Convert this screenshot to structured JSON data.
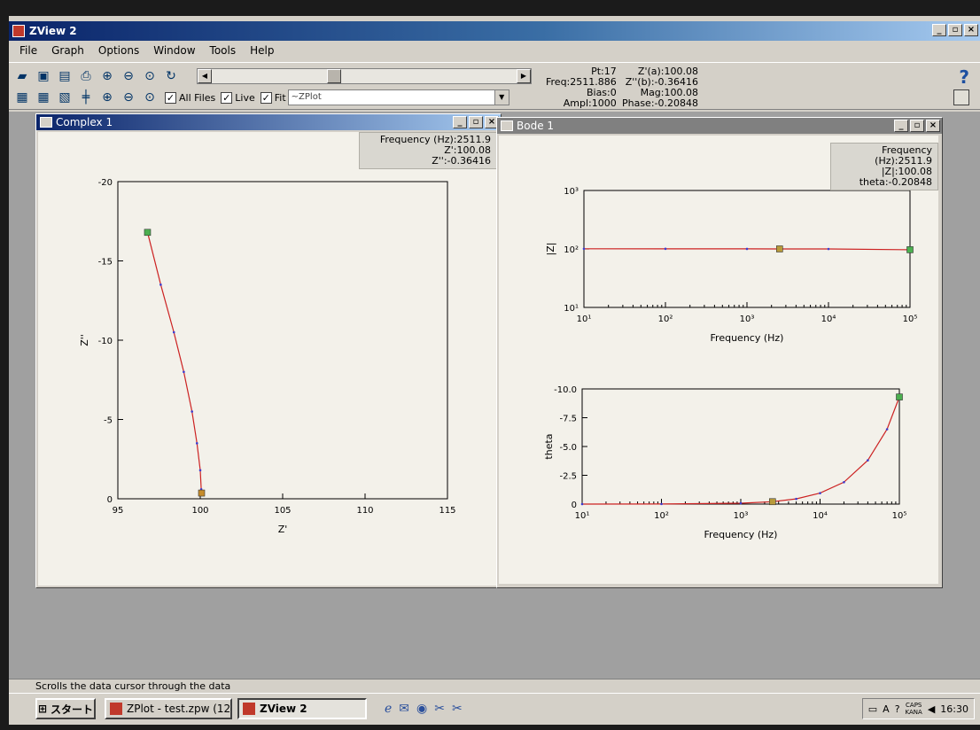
{
  "window": {
    "title": "ZView 2"
  },
  "menu": [
    {
      "label": "File"
    },
    {
      "label": "Graph"
    },
    {
      "label": "Options"
    },
    {
      "label": "Window"
    },
    {
      "label": "Tools"
    },
    {
      "label": "Help"
    }
  ],
  "toolbar": {
    "all_files_label": "All Files",
    "live_label": "Live",
    "fit_label": "Fit",
    "fit_value": "~ZPlot",
    "help_glyph": "?"
  },
  "readout": {
    "pt": "Pt:17",
    "freq": "Freq:2511.886",
    "bias": "Bias:0",
    "ampl": "Ampl:1000",
    "za": "Z'(a):100.08",
    "zb": "Z''(b):-0.36416",
    "mag": "Mag:100.08",
    "phase": "Phase:-0.20848"
  },
  "complex_window": {
    "title": "Complex 1",
    "info": [
      "Frequency (Hz):2511.9",
      "Z':100.08",
      "Z'':-0.36416"
    ]
  },
  "bode_window": {
    "title": "Bode 1",
    "info": [
      "Frequency (Hz):2511.9",
      "|Z|:100.08",
      "theta:-0.20848"
    ]
  },
  "chart_data": [
    {
      "type": "line",
      "xlabel": "Z'",
      "ylabel": "Z''",
      "xlim": [
        95,
        115
      ],
      "ylim": [
        0,
        -20
      ],
      "x_ticks": [
        "95",
        "100",
        "105",
        "110",
        "115"
      ],
      "y_ticks": [
        "-20",
        "-15",
        "-10",
        "-5",
        "0"
      ],
      "series": [
        {
          "x": [
            96.8,
            97.6,
            98.4,
            99.0,
            99.5,
            99.8,
            100.0,
            100.06,
            100.08
          ],
          "y": [
            -16.8,
            -13.5,
            -10.5,
            -8.0,
            -5.5,
            -3.5,
            -1.8,
            -0.6,
            -0.36
          ]
        }
      ]
    },
    {
      "type": "line",
      "xscale": "log",
      "yscale": "log",
      "xlabel": "Frequency (Hz)",
      "ylabel": "|Z|",
      "xlim": [
        10,
        100000
      ],
      "ylim": [
        10,
        1000
      ],
      "x_ticks": [
        "10¹",
        "10²",
        "10³",
        "10⁴",
        "10⁵"
      ],
      "y_ticks": [
        "10³",
        "10²",
        "10¹"
      ],
      "series": [
        {
          "x": [
            10,
            100,
            1000,
            2511.9,
            10000,
            100000
          ],
          "y": [
            100.8,
            100.5,
            100.2,
            100.08,
            99.9,
            97.0
          ]
        }
      ]
    },
    {
      "type": "line",
      "xscale": "log",
      "xlabel": "Frequency (Hz)",
      "ylabel": "theta",
      "xlim": [
        10,
        100000
      ],
      "ylim": [
        0,
        -10
      ],
      "x_ticks": [
        "10¹",
        "10²",
        "10³",
        "10⁴",
        "10⁵"
      ],
      "y_ticks": [
        "-10.0",
        "-7.5",
        "-5.0",
        "-2.5",
        "0"
      ],
      "series": [
        {
          "x": [
            10,
            100,
            1000,
            2511.9,
            5000,
            10000,
            20000,
            40000,
            70000,
            100000
          ],
          "y": [
            0,
            -0.01,
            -0.08,
            -0.21,
            -0.45,
            -0.95,
            -1.9,
            -3.8,
            -6.5,
            -9.3
          ]
        }
      ]
    }
  ],
  "status": {
    "text": "Scrolls the data cursor through the data"
  },
  "taskbar": {
    "start_label": "スタート",
    "task1": "ZPlot - test.zpw  (12...",
    "task2": "ZView 2",
    "clock": "16:30",
    "caps": "CAPS",
    "kana": "KANA"
  }
}
